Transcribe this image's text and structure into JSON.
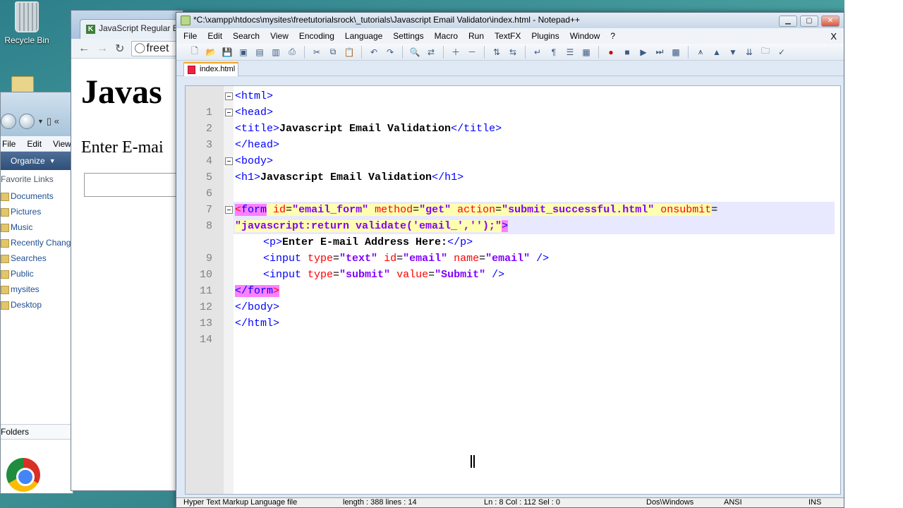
{
  "desktop": {
    "recycle_bin_label": "Recycle Bin"
  },
  "explorer": {
    "menu": [
      "File",
      "Edit",
      "View"
    ],
    "organize_label": "Organize",
    "favorites_header": "Favorite Links",
    "favorites": [
      "Documents",
      "Pictures",
      "Music",
      "Recently Chang",
      "Searches",
      "Public",
      "mysites",
      "Desktop"
    ],
    "folders_label": "Folders"
  },
  "browser": {
    "tab_title": "JavaScript Regular Ex",
    "url_text": "freet",
    "heading": "Javas",
    "prompt_text": "Enter E-mai"
  },
  "npp": {
    "title": "*C:\\xampp\\htdocs\\mysites\\freetutorialsrock\\_tutorials\\Javascript Email Validator\\index.html - Notepad++",
    "menu": [
      "File",
      "Edit",
      "Search",
      "View",
      "Encoding",
      "Language",
      "Settings",
      "Macro",
      "Run",
      "TextFX",
      "Plugins",
      "Window",
      "?"
    ],
    "close_x": "X",
    "file_tab": "index.html",
    "line_numbers": [
      "1",
      "2",
      "3",
      "4",
      "5",
      "6",
      "7",
      "8",
      "",
      "9",
      "10",
      "11",
      "12",
      "13",
      "14"
    ],
    "code": {
      "l1": "<html>",
      "l2": "<head>",
      "l3_open": "<title>",
      "l3_text": "Javascript Email Validation",
      "l3_close": "</title>",
      "l4": "</head>",
      "l5": "<body>",
      "l6_open": "<h1>",
      "l6_text": "Javascript Email Validation",
      "l6_close": "</h1>",
      "l8_lt": "<",
      "l8_tag": "form",
      "l8_a1": " id",
      "l8_v1": "\"email_form\"",
      "l8_a2": " method",
      "l8_v2": "\"get\"",
      "l8_a3": " action",
      "l8_v3": "\"submit_successful.html\"",
      "l8_a4": " onsubmit",
      "l8_eq": "=",
      "l8b_val": "\"javascript:return validate('email_','');\"",
      "l8b_gt": ">",
      "l9_open": "<p>",
      "l9_text": "Enter E-mail Address Here:",
      "l9_close": "</p>",
      "l10_tag": "<input",
      "l10_a1": " type",
      "l10_v1": "\"text\"",
      "l10_a2": " id",
      "l10_v2": "\"email\"",
      "l10_a3": " name",
      "l10_v3": "\"email\"",
      "l10_end": " />",
      "l11_tag": "<input",
      "l11_a1": " type",
      "l11_v1": "\"submit\"",
      "l11_a2": " value",
      "l11_v2": "\"Submit\"",
      "l11_end": " />",
      "l12_open": "</form",
      "l12_gt": ">",
      "l13": "</body>",
      "l14": "</html>"
    },
    "status": {
      "lang": "Hyper Text Markup Language file",
      "length": "length : 388    lines : 14",
      "pos": "Ln : 8    Col : 112    Sel : 0",
      "eol": "Dos\\Windows",
      "enc": "ANSI",
      "mode": "INS"
    }
  }
}
